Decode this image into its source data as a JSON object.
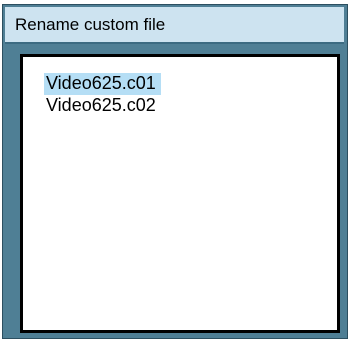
{
  "dialog": {
    "title": "Rename custom file"
  },
  "file_list": {
    "items": [
      {
        "label": "Video625.c01",
        "selected": true
      },
      {
        "label": "Video625.c02",
        "selected": false
      }
    ]
  },
  "colors": {
    "dialog_background": "#4f7f95",
    "title_bar_background": "#cde3f0",
    "list_background": "#ffffff",
    "selection_highlight": "#b5def5"
  }
}
